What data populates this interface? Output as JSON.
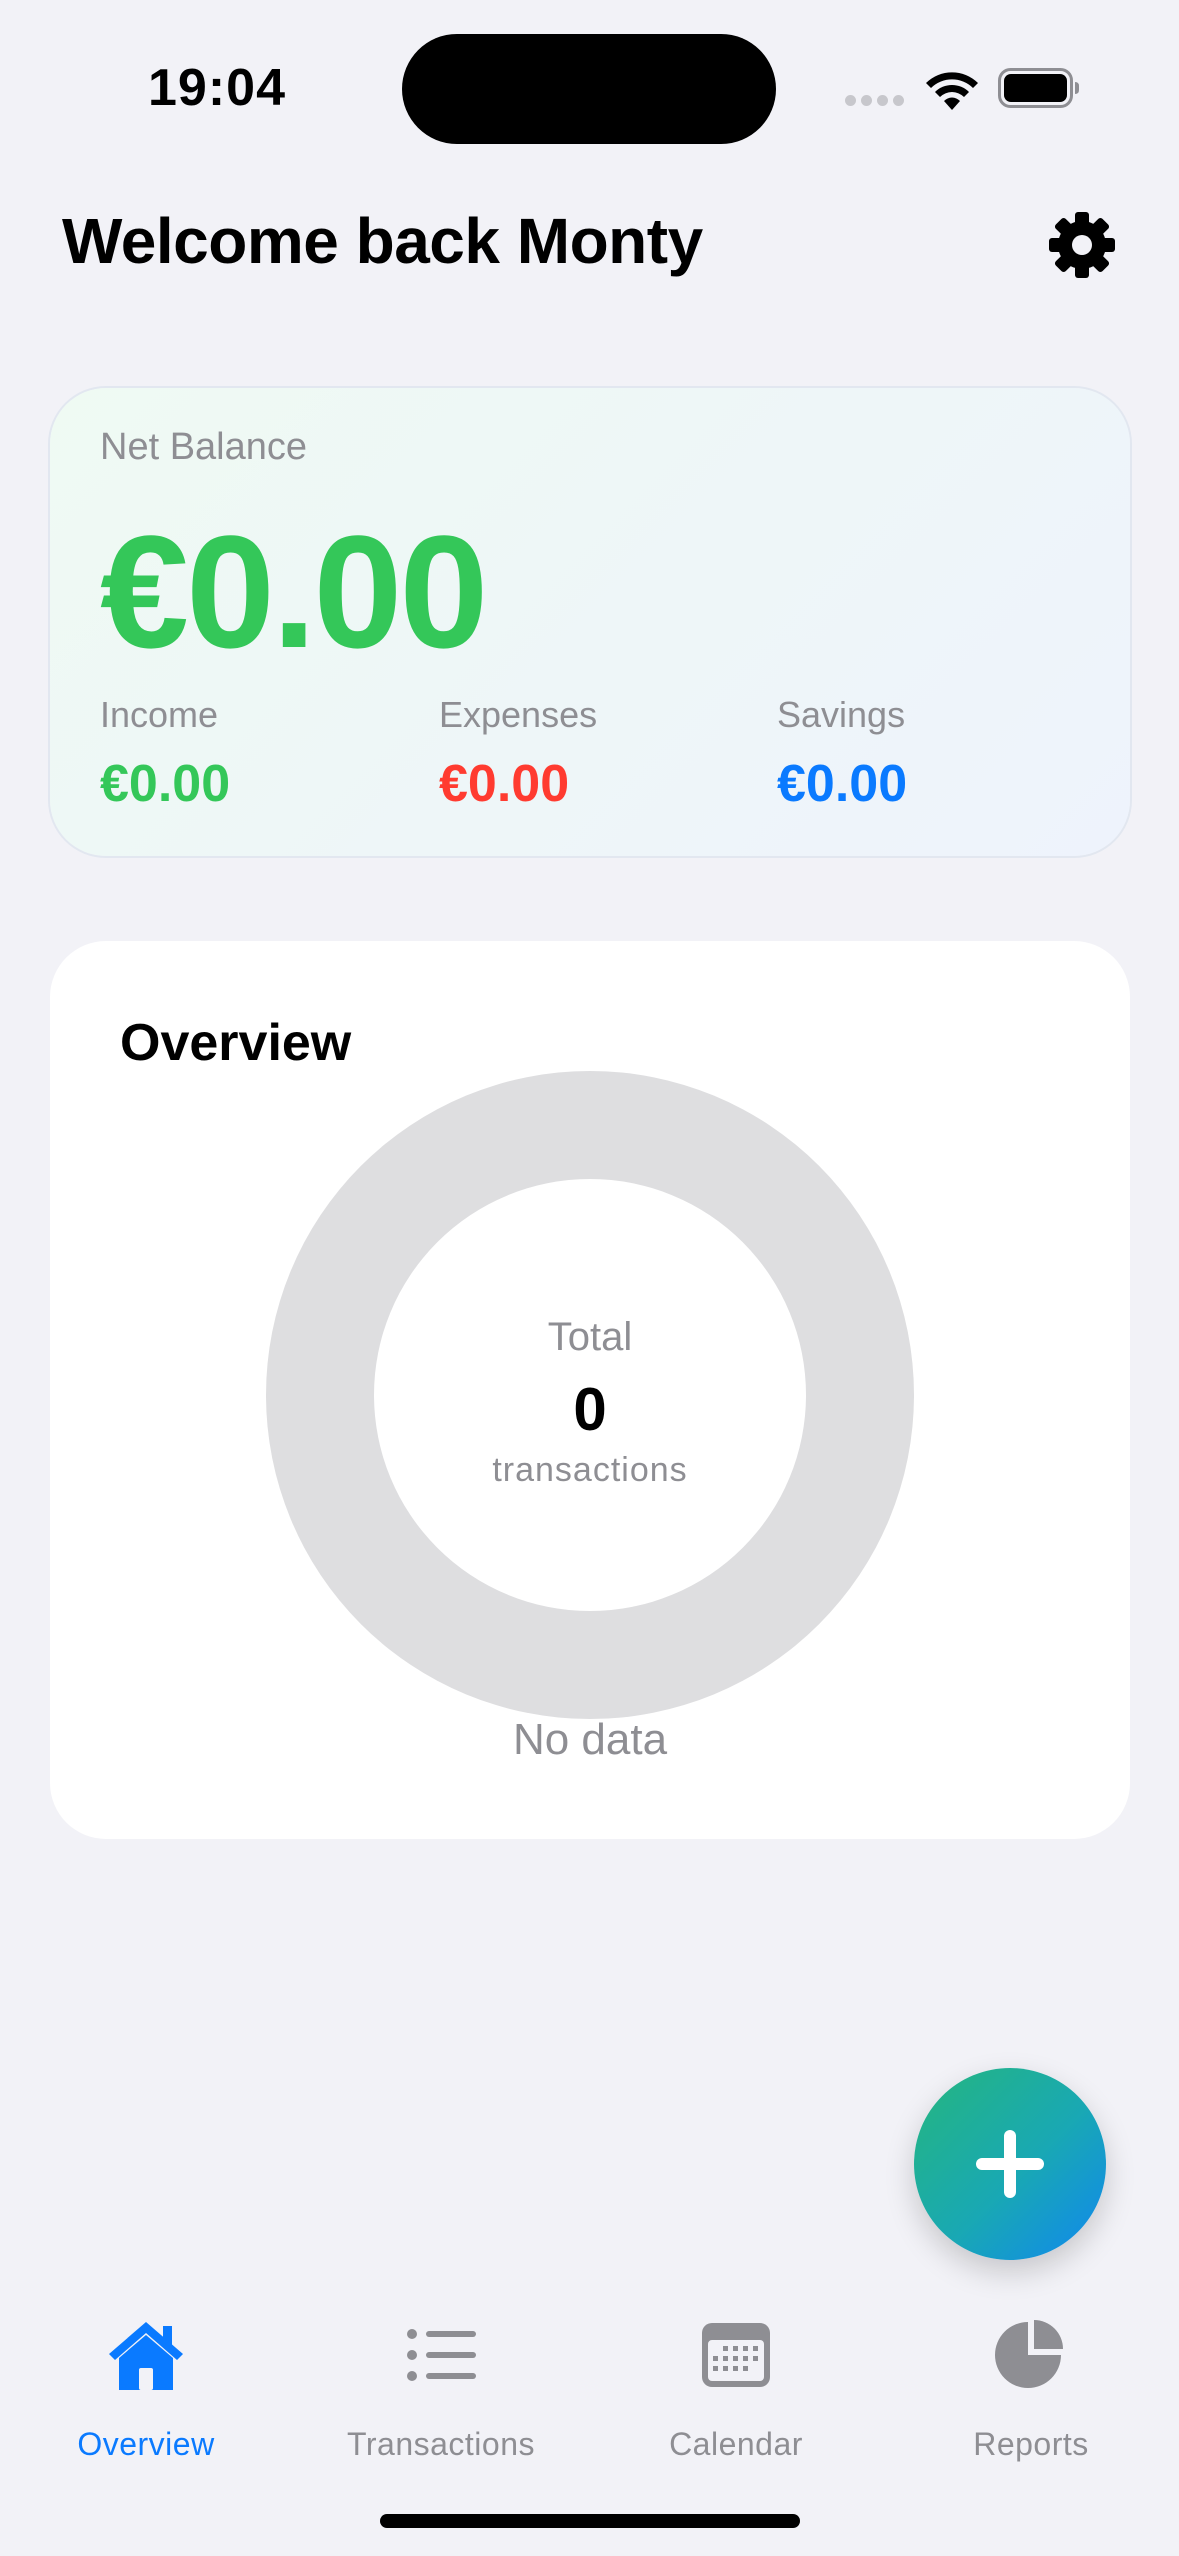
{
  "status_bar": {
    "time": "19:04"
  },
  "header": {
    "title": "Welcome back Monty"
  },
  "balance": {
    "net_label": "Net Balance",
    "net_value": "€0.00",
    "income_label": "Income",
    "income_value": "€0.00",
    "expenses_label": "Expenses",
    "expenses_value": "€0.00",
    "savings_label": "Savings",
    "savings_value": "€0.00"
  },
  "overview": {
    "title": "Overview",
    "total_label": "Total",
    "total_count": "0",
    "total_unit": "transactions",
    "empty_text": "No data"
  },
  "tabs": [
    {
      "label": "Overview",
      "icon": "house-icon",
      "active": true
    },
    {
      "label": "Transactions",
      "icon": "list-icon",
      "active": false
    },
    {
      "label": "Calendar",
      "icon": "calendar-icon",
      "active": false
    },
    {
      "label": "Reports",
      "icon": "pie-chart-icon",
      "active": false
    }
  ],
  "colors": {
    "income": "#34c759",
    "expenses": "#ff3b30",
    "savings": "#0a7aff",
    "accent": "#0a7aff",
    "inactive": "#8e8e93"
  }
}
